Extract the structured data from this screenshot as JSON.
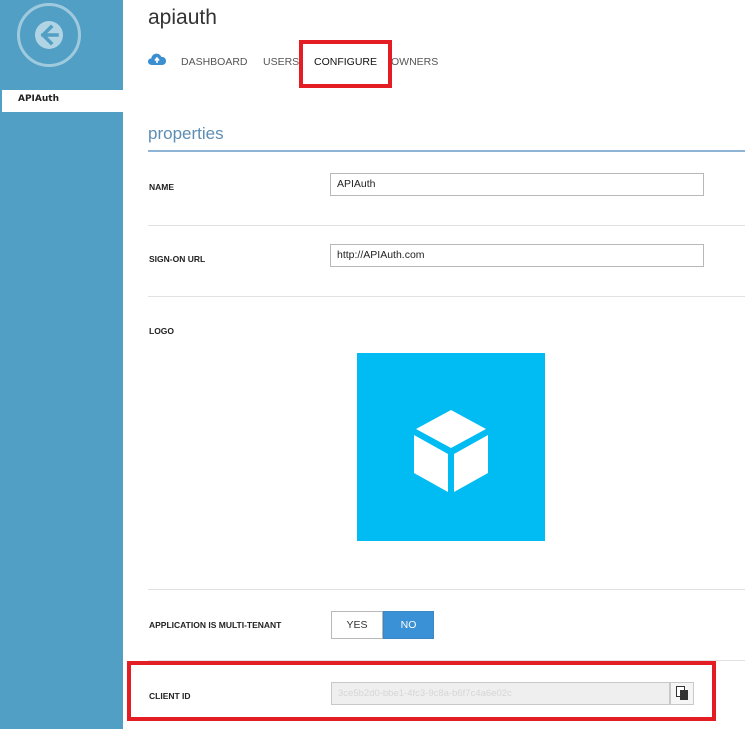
{
  "app": {
    "title": "apiauth"
  },
  "sidebar": {
    "back_icon": "arrow-left-icon",
    "items": [
      {
        "label": "APIAuth",
        "selected": true
      }
    ]
  },
  "nav": {
    "icon": "cloud-icon",
    "tabs": [
      {
        "label": "DASHBOARD",
        "active": false
      },
      {
        "label": "USERS",
        "active": false
      },
      {
        "label": "CONFIGURE",
        "active": true
      },
      {
        "label": "OWNERS",
        "active": false
      }
    ]
  },
  "properties": {
    "section_title": "properties",
    "name": {
      "label": "NAME",
      "value": "APIAuth"
    },
    "sign_on_url": {
      "label": "SIGN-ON URL",
      "value": "http://APIAuth.com"
    },
    "logo": {
      "label": "LOGO",
      "icon": "cube-icon",
      "tile_color": "#00bcf2"
    },
    "multi_tenant": {
      "label": "APPLICATION IS MULTI-TENANT",
      "options": [
        "YES",
        "NO"
      ],
      "selected": "NO"
    },
    "client_id": {
      "label": "CLIENT ID",
      "value": "3ce5b2d0-bbe1-4fc3-9c8a-b6f7c4a6e02c",
      "copy_icon": "copy-icon"
    }
  },
  "colors": {
    "sidebar": "#519fc4",
    "accent": "#3b91d6",
    "highlight": "#e41c24",
    "section_title": "#5d8db3"
  }
}
